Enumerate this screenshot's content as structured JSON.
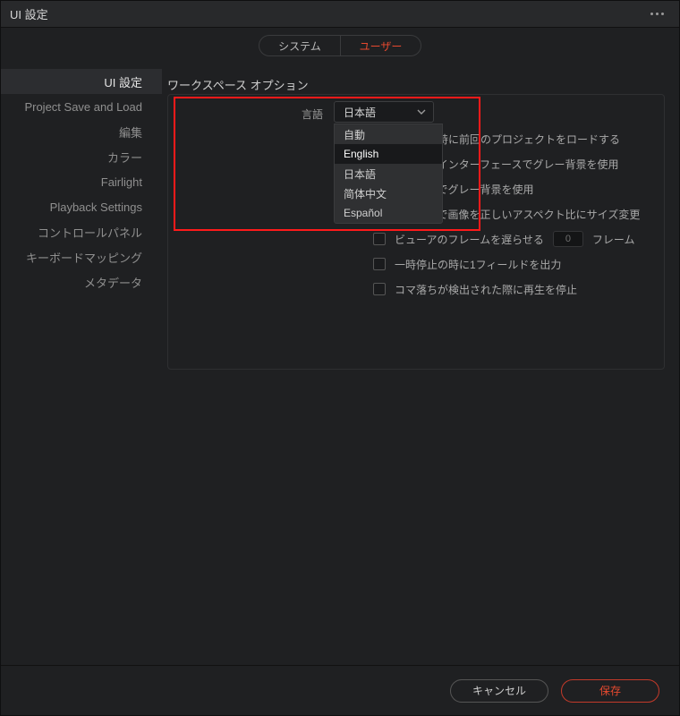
{
  "window": {
    "title": "UI 設定"
  },
  "tabs": {
    "system": "システム",
    "user": "ユーザー"
  },
  "sidebar": {
    "items": [
      {
        "label": "UI 設定",
        "active": true
      },
      {
        "label": "Project Save and Load"
      },
      {
        "label": "編集"
      },
      {
        "label": "カラー"
      },
      {
        "label": "Fairlight"
      },
      {
        "label": "Playback Settings"
      },
      {
        "label": "コントロールパネル"
      },
      {
        "label": "キーボードマッピング"
      },
      {
        "label": "メタデータ"
      }
    ]
  },
  "content": {
    "section_title": "ワークスペース オプション",
    "language_label": "言語",
    "language_selected": "日本語",
    "language_options": [
      "自動",
      "English",
      "日本語",
      "简体中文",
      "Español"
    ],
    "language_highlight_index": 1,
    "rows": {
      "load_last": "ログイン時に前回のプロジェクトをロードする",
      "gray_bg_user": "ユーザーインターフェースでグレー背景を使用",
      "gray_bg_viewer": "ビューアでグレー背景を使用",
      "resize_aspect": "ビューアで画像を正しいアスペクト比にサイズ変更",
      "delay_frames": "ビューアのフレームを遅らせる",
      "delay_value": "0",
      "delay_unit": "フレーム",
      "output_field": "一時停止の時に1フィールドを出力",
      "stop_on_drop": "コマ落ちが検出された際に再生を停止"
    }
  },
  "footer": {
    "cancel": "キャンセル",
    "save": "保存"
  },
  "colors": {
    "accent": "#e6492f"
  }
}
